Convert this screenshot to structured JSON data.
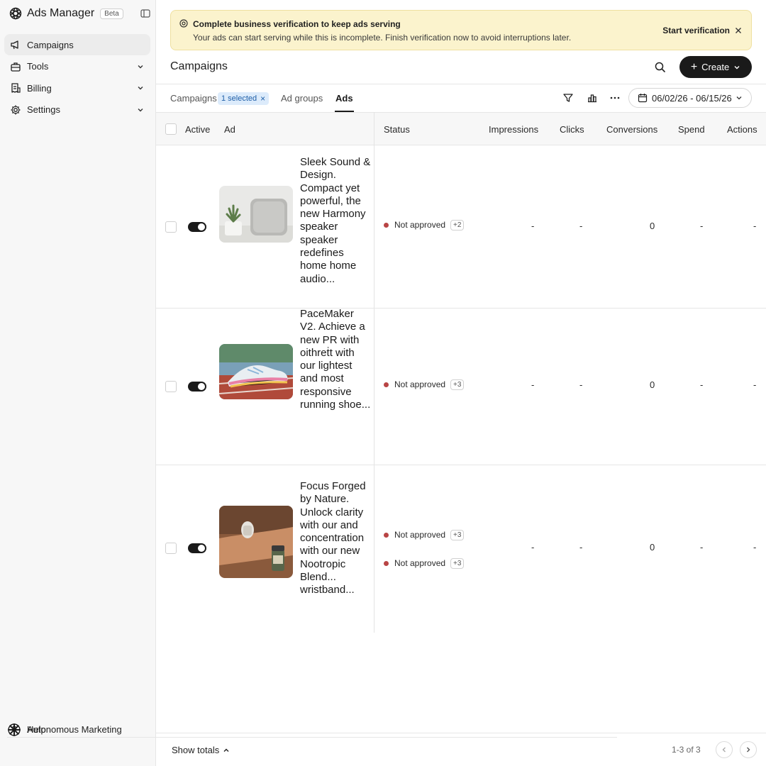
{
  "app": {
    "title": "Ads Manager",
    "badge": "Beta"
  },
  "sidebar": {
    "items": [
      {
        "label": "Campaigns",
        "icon": "megaphone-icon",
        "active": true
      },
      {
        "label": "Tools",
        "icon": "briefcase-icon"
      },
      {
        "label": "Billing",
        "icon": "receipt-icon"
      },
      {
        "label": "Settings",
        "icon": "gear-icon"
      }
    ],
    "bottom": [
      {
        "label": "Autonomous Marketing",
        "icon": "sparkle-icon"
      },
      {
        "label": "Help",
        "icon": "help-icon"
      }
    ]
  },
  "banner": {
    "title": "Complete business verification to keep ads serving",
    "message": "Your ads can start serving while this is incomplete. Finish verification now to avoid interruptions later.",
    "action": "Start verification"
  },
  "header": {
    "title": "Campaigns",
    "create_label": "Create"
  },
  "tabs": {
    "campaigns": "Campaigns",
    "selected_pill": "1 selected",
    "ad_groups": "Ad groups",
    "ads": "Ads",
    "date_range": "06/02/26 - 06/15/26"
  },
  "table": {
    "columns": {
      "active": "Active",
      "ad": "Ad",
      "status": "Status",
      "impressions": "Impressions",
      "clicks": "Clicks",
      "conversions": "Conversions",
      "spend": "Spend",
      "actions": "Actions"
    },
    "rows": [
      {
        "ad_text": "Sleek Sound & Design. Compact yet powerful, the new Harmony speaker speaker redefines home home audio...",
        "image": "smart-speaker-photo",
        "statuses": [
          {
            "label": "Not approved",
            "extra": "+2"
          }
        ],
        "impressions": "-",
        "clicks": "-",
        "conversions": "0",
        "spend": "-",
        "actions": "-"
      },
      {
        "ad_text": "PaceMaker V2. Achieve a new PR with oithreṫt with our lightest and most responsive running shoe...",
        "image": "running-shoe-photo",
        "statuses": [
          {
            "label": "Not approved",
            "extra": "+3"
          }
        ],
        "impressions": "-",
        "clicks": "-",
        "conversions": "0",
        "spend": "-",
        "actions": "-"
      },
      {
        "ad_text": "Focus Forged by Nature. Unlock clarity with our and concentration with our new Nootropic Blend... wristband...",
        "image": "wristband-supplement-photo",
        "statuses": [
          {
            "label": "Not approved",
            "extra": "+3"
          },
          {
            "label": "Not approved",
            "extra": "+3"
          }
        ],
        "impressions": "-",
        "clicks": "-",
        "conversions": "0",
        "spend": "-",
        "actions": "-"
      }
    ]
  },
  "footer": {
    "show_totals": "Show totals",
    "pagination": "1-3 of 3"
  },
  "colors": {
    "banner_bg": "#fbf3cd",
    "status_dot": "#b84545",
    "pill_bg": "#dcebfb",
    "primary": "#1a1a1a"
  }
}
